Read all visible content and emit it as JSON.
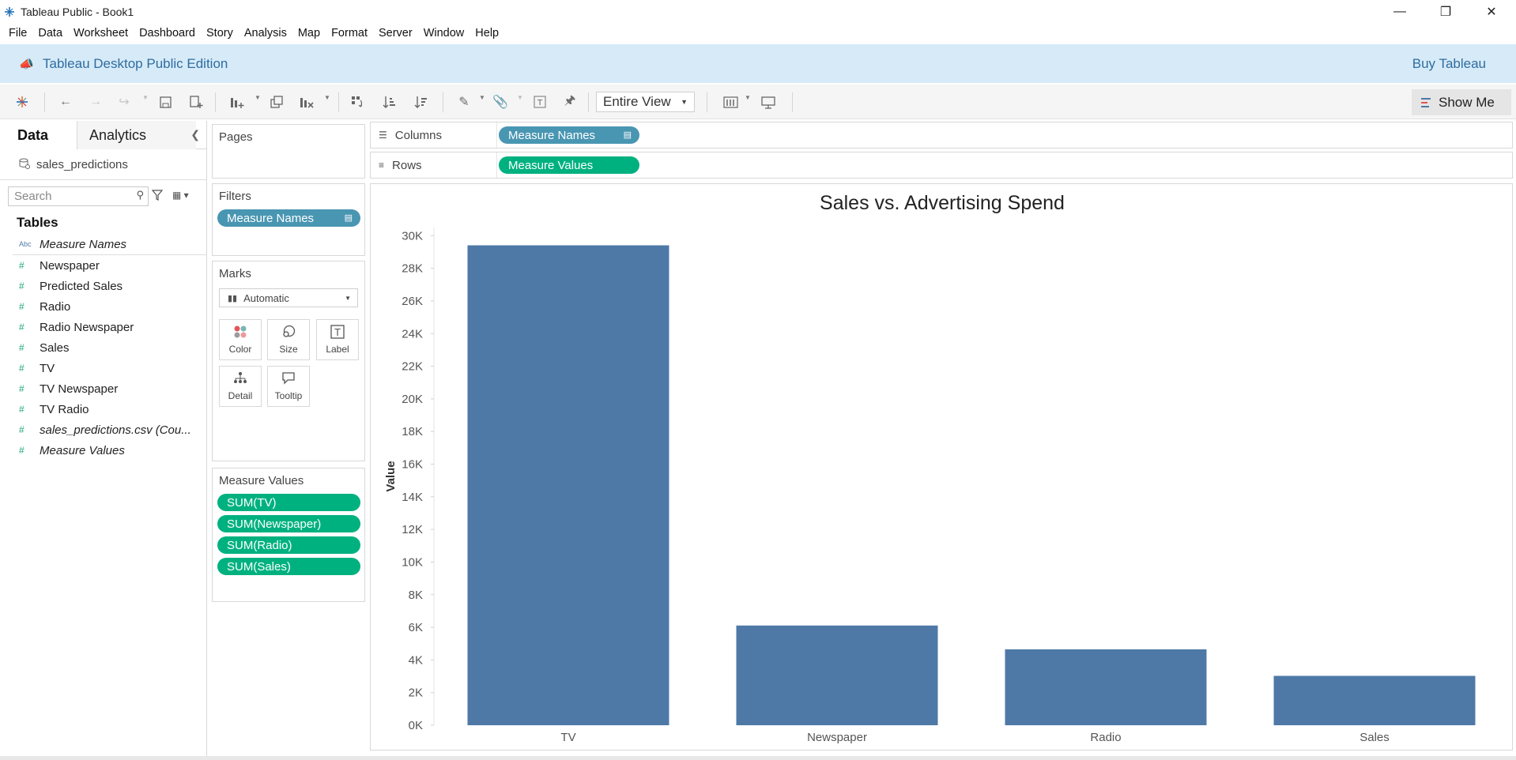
{
  "window": {
    "title": "Tableau Public - Book1",
    "controls": [
      "minimize",
      "restore",
      "close"
    ]
  },
  "menu": [
    "File",
    "Data",
    "Worksheet",
    "Dashboard",
    "Story",
    "Analysis",
    "Map",
    "Format",
    "Server",
    "Window",
    "Help"
  ],
  "banner": {
    "edition": "Tableau Desktop Public Edition",
    "buy": "Buy Tableau"
  },
  "toolbar": {
    "fit_mode": "Entire View",
    "show_me": "Show Me"
  },
  "data_pane": {
    "tabs": [
      "Data",
      "Analytics"
    ],
    "active_tab": "Data",
    "datasource": "sales_predictions",
    "search_placeholder": "Search",
    "tables_heading": "Tables",
    "fields": [
      {
        "name": "Measure Names",
        "type": "dimension",
        "icon": "Abc",
        "italic": true
      },
      {
        "name": "Newspaper",
        "type": "measure",
        "icon": "#",
        "italic": false
      },
      {
        "name": "Predicted Sales",
        "type": "measure",
        "icon": "#",
        "italic": false
      },
      {
        "name": "Radio",
        "type": "measure",
        "icon": "#",
        "italic": false
      },
      {
        "name": "Radio Newspaper",
        "type": "measure",
        "icon": "#",
        "italic": false
      },
      {
        "name": "Sales",
        "type": "measure",
        "icon": "#",
        "italic": false
      },
      {
        "name": "TV",
        "type": "measure",
        "icon": "#",
        "italic": false
      },
      {
        "name": "TV Newspaper",
        "type": "measure",
        "icon": "#",
        "italic": false
      },
      {
        "name": "TV Radio",
        "type": "measure",
        "icon": "#",
        "italic": false
      },
      {
        "name": "sales_predictions.csv (Cou...",
        "type": "measure",
        "icon": "#",
        "italic": true
      },
      {
        "name": "Measure Values",
        "type": "measure",
        "icon": "#",
        "italic": true
      }
    ]
  },
  "shelves": {
    "pages_label": "Pages",
    "filters_label": "Filters",
    "filters_pill": "Measure Names",
    "marks_label": "Marks",
    "marks_type": "Automatic",
    "mark_buttons": [
      "Color",
      "Size",
      "Label",
      "Detail",
      "Tooltip"
    ],
    "measure_values_label": "Measure Values",
    "measure_values_pills": [
      "SUM(TV)",
      "SUM(Newspaper)",
      "SUM(Radio)",
      "SUM(Sales)"
    ],
    "columns_label": "Columns",
    "columns_pill": "Measure Names",
    "rows_label": "Rows",
    "rows_pill": "Measure Values"
  },
  "colors": {
    "bar": "#4e79a7",
    "pill_dimension": "#4996b2",
    "pill_measure": "#00b180",
    "banner_bg": "#d6eaf8",
    "banner_text": "#2f6d9f"
  },
  "chart_data": {
    "type": "bar",
    "title": "Sales vs. Advertising Spend",
    "xlabel": "",
    "ylabel": "Value",
    "categories": [
      "TV",
      "Newspaper",
      "Radio",
      "Sales"
    ],
    "values": [
      29409,
      6111,
      4653,
      3026
    ],
    "ylim": [
      0,
      30500
    ],
    "yticks": [
      0,
      2000,
      4000,
      6000,
      8000,
      10000,
      12000,
      14000,
      16000,
      18000,
      20000,
      22000,
      24000,
      26000,
      28000,
      30000
    ],
    "ytick_labels": [
      "0K",
      "2K",
      "4K",
      "6K",
      "8K",
      "10K",
      "12K",
      "14K",
      "16K",
      "18K",
      "20K",
      "22K",
      "24K",
      "26K",
      "28K",
      "30K"
    ],
    "grid": false,
    "legend": "none"
  }
}
